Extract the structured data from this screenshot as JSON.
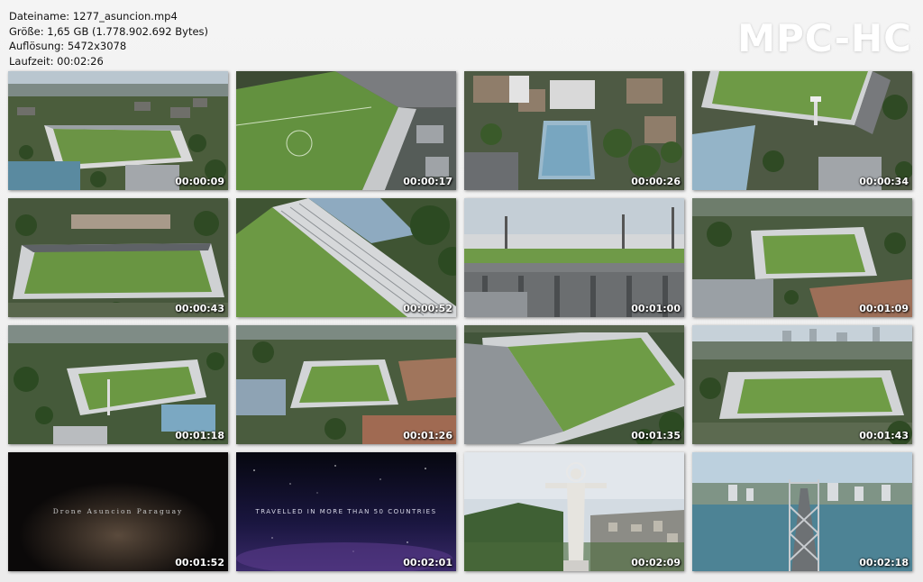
{
  "header": {
    "filename": "Dateiname: 1277_asuncion.mp4",
    "size": "Größe: 1,65 GB (1.778.902.692 Bytes)",
    "resolution": "Auflösung: 5472x3078",
    "duration": "Laufzeit: 00:02:26"
  },
  "logo": {
    "text": "MPC-HC"
  },
  "thumbnails": [
    {
      "time": "00:00:09",
      "scene": "stadium-wide"
    },
    {
      "time": "00:00:17",
      "scene": "pitch-closeup"
    },
    {
      "time": "00:00:26",
      "scene": "city-pool"
    },
    {
      "time": "00:00:34",
      "scene": "stadium-corner"
    },
    {
      "time": "00:00:43",
      "scene": "stadium-full"
    },
    {
      "time": "00:00:52",
      "scene": "stands-diagonal"
    },
    {
      "time": "00:01:00",
      "scene": "stands-eye-level"
    },
    {
      "time": "00:01:09",
      "scene": "stadium-distant"
    },
    {
      "time": "00:01:18",
      "scene": "stadium-tilted"
    },
    {
      "time": "00:01:26",
      "scene": "stadium-small"
    },
    {
      "time": "00:01:35",
      "scene": "stadium-low"
    },
    {
      "time": "00:01:43",
      "scene": "stadium-skyline"
    },
    {
      "time": "00:01:52",
      "scene": "title-dark",
      "title": "Drone Asuncion Paraguay"
    },
    {
      "time": "00:02:01",
      "scene": "title-space",
      "title": "TRAVELLED IN MORE THAN 50 COUNTRIES"
    },
    {
      "time": "00:02:09",
      "scene": "statue"
    },
    {
      "time": "00:02:18",
      "scene": "bridge"
    }
  ],
  "colors": {
    "pitch": "#5f8c3c",
    "pitch_light": "#79a34c",
    "trees": "#3c5a2c",
    "roof": "#8a8d92",
    "sky": "#c7d3dc",
    "water": "#4f8596"
  }
}
